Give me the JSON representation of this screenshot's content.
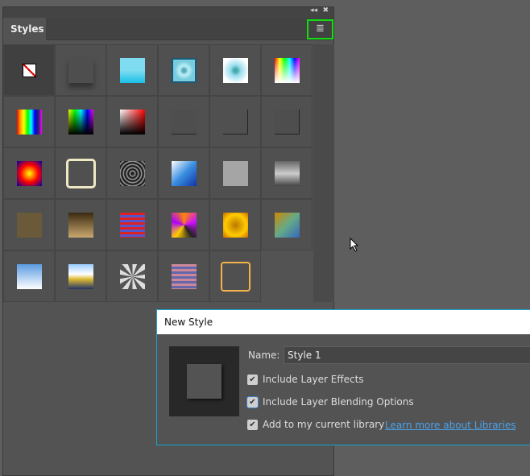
{
  "panel": {
    "tab_label": "Styles",
    "collapse_icon": "double-chevron-left-icon",
    "close_icon": "close-icon",
    "menu_icon": "hamburger-menu-icon"
  },
  "dialog": {
    "title": "New Style",
    "name_label": "Name:",
    "name_value": "Style 1",
    "checkboxes": [
      {
        "label": "Include Layer Effects",
        "checked": true
      },
      {
        "label": "Include Layer Blending Options",
        "checked": true
      },
      {
        "label": "Add to my current library",
        "checked": true
      }
    ],
    "link": "Learn more about Libraries"
  }
}
